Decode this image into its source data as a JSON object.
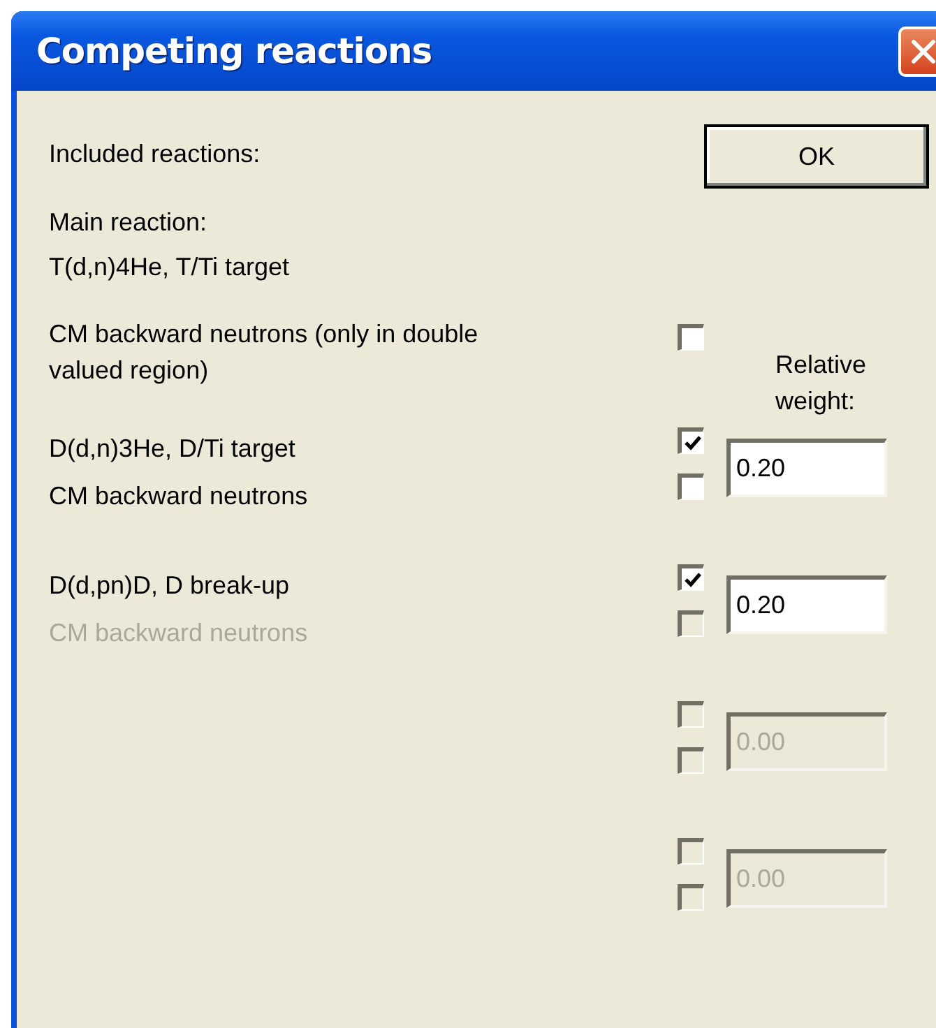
{
  "window": {
    "title": "Competing reactions"
  },
  "ok_button": {
    "label": "OK"
  },
  "included_label": "Included reactions:",
  "main_reaction": {
    "heading": "Main reaction:",
    "name": "T(d,n)4He, T/Ti target",
    "backward": {
      "label": "CM backward neutrons (only in double valued region)",
      "checked": false,
      "disabled": false
    }
  },
  "weight_heading": "Relative weight:",
  "reactions": [
    {
      "name": "D(d,n)3He, D/Ti target",
      "included": true,
      "disabled": false,
      "weight": "0.20",
      "backward": {
        "label": "CM backward neutrons",
        "checked": false,
        "disabled": false
      }
    },
    {
      "name": "D(d,pn)D, D break-up",
      "included": true,
      "disabled": false,
      "weight": "0.20",
      "backward": {
        "label": "CM backward neutrons",
        "checked": false,
        "disabled": true
      }
    },
    {
      "included": false,
      "disabled": true,
      "weight": "0.00",
      "backward": {
        "checked": false,
        "disabled": true
      }
    },
    {
      "included": false,
      "disabled": true,
      "weight": "0.00",
      "backward": {
        "checked": false,
        "disabled": true
      }
    }
  ]
}
